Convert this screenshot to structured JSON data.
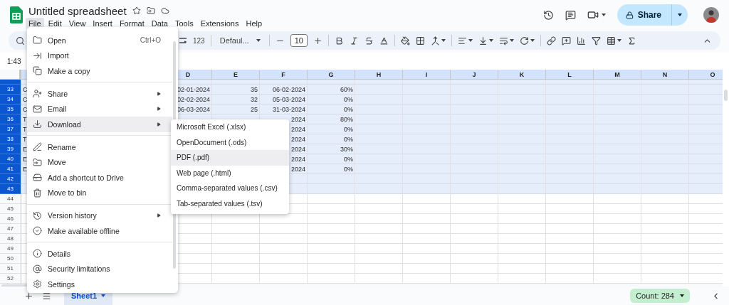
{
  "document": {
    "title": "Untitled spreadsheet"
  },
  "menubar": [
    {
      "label": "File",
      "selected": true
    },
    {
      "label": "Edit",
      "selected": false
    },
    {
      "label": "View",
      "selected": false
    },
    {
      "label": "Insert",
      "selected": false
    },
    {
      "label": "Format",
      "selected": false
    },
    {
      "label": "Data",
      "selected": false
    },
    {
      "label": "Tools",
      "selected": false
    },
    {
      "label": "Extensions",
      "selected": false
    },
    {
      "label": "Help",
      "selected": false
    }
  ],
  "share_button": {
    "label": "Share"
  },
  "toolbar": {
    "number_format": "123",
    "font": "Defaul...",
    "font_size": "10"
  },
  "name_box": "1:43",
  "columns": [
    "D",
    "E",
    "F",
    "G",
    "H",
    "I",
    "J",
    "K",
    "L",
    "M",
    "N",
    "O"
  ],
  "rows": [
    {
      "selected": true,
      "cut": true
    },
    {
      "number": "33",
      "selected": true,
      "col_a": "C",
      "col_d": "02-01-2024",
      "col_e": "35",
      "col_f": "06-02-2024",
      "col_g": "60%"
    },
    {
      "number": "34",
      "selected": true,
      "col_a": "C",
      "col_d": "02-02-2024",
      "col_e": "32",
      "col_f": "05-03-2024",
      "col_g": "0%"
    },
    {
      "number": "35",
      "selected": true,
      "col_a": "C",
      "col_d": "06-03-2024",
      "col_e": "25",
      "col_f": "31-03-2024",
      "col_g": "0%"
    },
    {
      "number": "36",
      "selected": true,
      "col_a": "T",
      "col_f": "2024",
      "col_g": "80%"
    },
    {
      "number": "37",
      "selected": true,
      "col_a": "T",
      "col_f": "2024",
      "col_g": "0%"
    },
    {
      "number": "38",
      "selected": true,
      "col_a": "T",
      "col_f": "2024",
      "col_g": "0%"
    },
    {
      "number": "39",
      "selected": true,
      "col_a": "E",
      "col_f": "2024",
      "col_g": "30%"
    },
    {
      "number": "40",
      "selected": true,
      "col_a": "E",
      "col_f": "2024",
      "col_g": "0%"
    },
    {
      "number": "41",
      "selected": true,
      "col_a": "E",
      "col_f": "2024",
      "col_g": "0%"
    },
    {
      "number": "42",
      "selected": true
    },
    {
      "number": "43",
      "selected": true
    },
    {
      "number": "44",
      "selected": false
    },
    {
      "number": "45",
      "selected": false
    },
    {
      "number": "46",
      "selected": false
    },
    {
      "number": "47",
      "selected": false
    },
    {
      "number": "48",
      "selected": false
    },
    {
      "number": "49",
      "selected": false
    },
    {
      "number": "50",
      "selected": false
    },
    {
      "number": "51",
      "selected": false
    },
    {
      "number": "52",
      "selected": false
    }
  ],
  "file_menu": [
    {
      "kind": "item",
      "label": "Open",
      "shortcut": "Ctrl+O",
      "submenu": false,
      "highlighted": false
    },
    {
      "kind": "item",
      "label": "Import",
      "submenu": false,
      "highlighted": false
    },
    {
      "kind": "item",
      "label": "Make a copy",
      "submenu": false,
      "highlighted": false
    },
    {
      "kind": "divider"
    },
    {
      "kind": "item",
      "label": "Share",
      "submenu": true,
      "highlighted": false
    },
    {
      "kind": "item",
      "label": "Email",
      "submenu": true,
      "highlighted": false
    },
    {
      "kind": "item",
      "label": "Download",
      "submenu": true,
      "highlighted": true
    },
    {
      "kind": "divider"
    },
    {
      "kind": "item",
      "label": "Rename",
      "submenu": false,
      "highlighted": false
    },
    {
      "kind": "item",
      "label": "Move",
      "submenu": false,
      "highlighted": false
    },
    {
      "kind": "item",
      "label": "Add a shortcut to Drive",
      "submenu": false,
      "highlighted": false
    },
    {
      "kind": "item",
      "label": "Move to bin",
      "submenu": false,
      "highlighted": false
    },
    {
      "kind": "divider"
    },
    {
      "kind": "item",
      "label": "Version history",
      "submenu": true,
      "highlighted": false
    },
    {
      "kind": "item",
      "label": "Make available offline",
      "submenu": false,
      "highlighted": false
    },
    {
      "kind": "divider"
    },
    {
      "kind": "item",
      "label": "Details",
      "submenu": false,
      "highlighted": false
    },
    {
      "kind": "item",
      "label": "Security limitations",
      "submenu": false,
      "highlighted": false
    },
    {
      "kind": "item",
      "label": "Settings",
      "submenu": false,
      "highlighted": false
    }
  ],
  "download_menu": [
    {
      "label": "Microsoft Excel (.xlsx)",
      "highlighted": false
    },
    {
      "label": "OpenDocument (.ods)",
      "highlighted": false
    },
    {
      "label": "PDF (.pdf)",
      "highlighted": true
    },
    {
      "label": "Web page (.html)",
      "highlighted": false
    },
    {
      "label": "Comma-separated values (.csv)",
      "highlighted": false
    },
    {
      "label": "Tab-separated values (.tsv)",
      "highlighted": false
    }
  ],
  "sheets": [
    {
      "label": "Sheet1",
      "selected": true
    }
  ],
  "status": {
    "count": "Count: 284"
  }
}
